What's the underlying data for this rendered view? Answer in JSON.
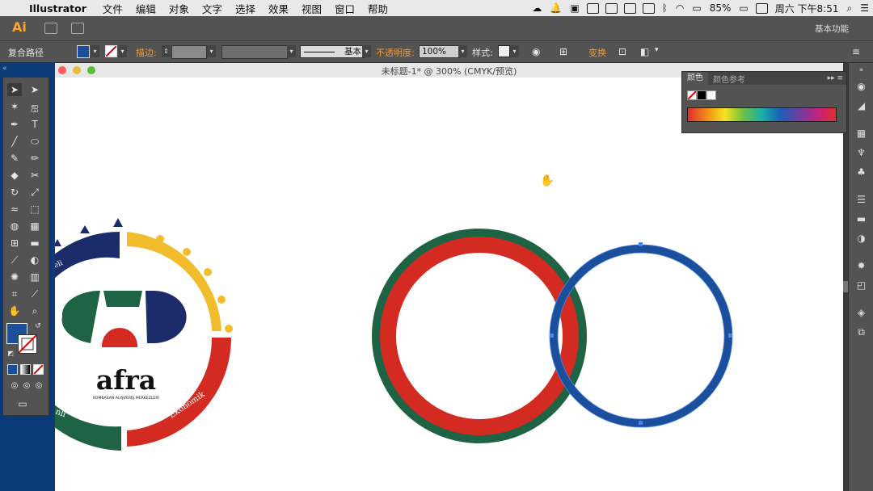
{
  "menubar": {
    "app": "Illustrator",
    "items": [
      "文件",
      "编辑",
      "对象",
      "文字",
      "选择",
      "效果",
      "视图",
      "窗口",
      "帮助"
    ],
    "battery": "85%",
    "clock": "周六 下午8:51"
  },
  "appbar": {
    "logo": "Ai",
    "workspace": "基本功能"
  },
  "control": {
    "object_type": "复合路径",
    "stroke_label": "描边:",
    "stroke_style": "基本",
    "opacity_label": "不透明度:",
    "opacity_value": "100%",
    "style_label": "样式:",
    "transform_label": "变换"
  },
  "document": {
    "title": "未标题-1* @ 300% (CMYK/预览)"
  },
  "color_panel": {
    "tab_color": "颜色",
    "tab_guide": "颜色参考"
  },
  "logo_art": {
    "brand": "afra",
    "tagline": "KOMBASAN ALIŞVERİŞ MERKEZLERİ",
    "arc_right": "Ekonomik",
    "arc_left_bottom": "nli",
    "arc_left_top": "eli"
  },
  "colors": {
    "green": "#1e6444",
    "red": "#d32a22",
    "blue": "#1b4f9c",
    "navy": "#1c2c6b",
    "yellow": "#f2bd2c",
    "ui_dark": "#535353",
    "ai_orange": "#f7a631"
  }
}
